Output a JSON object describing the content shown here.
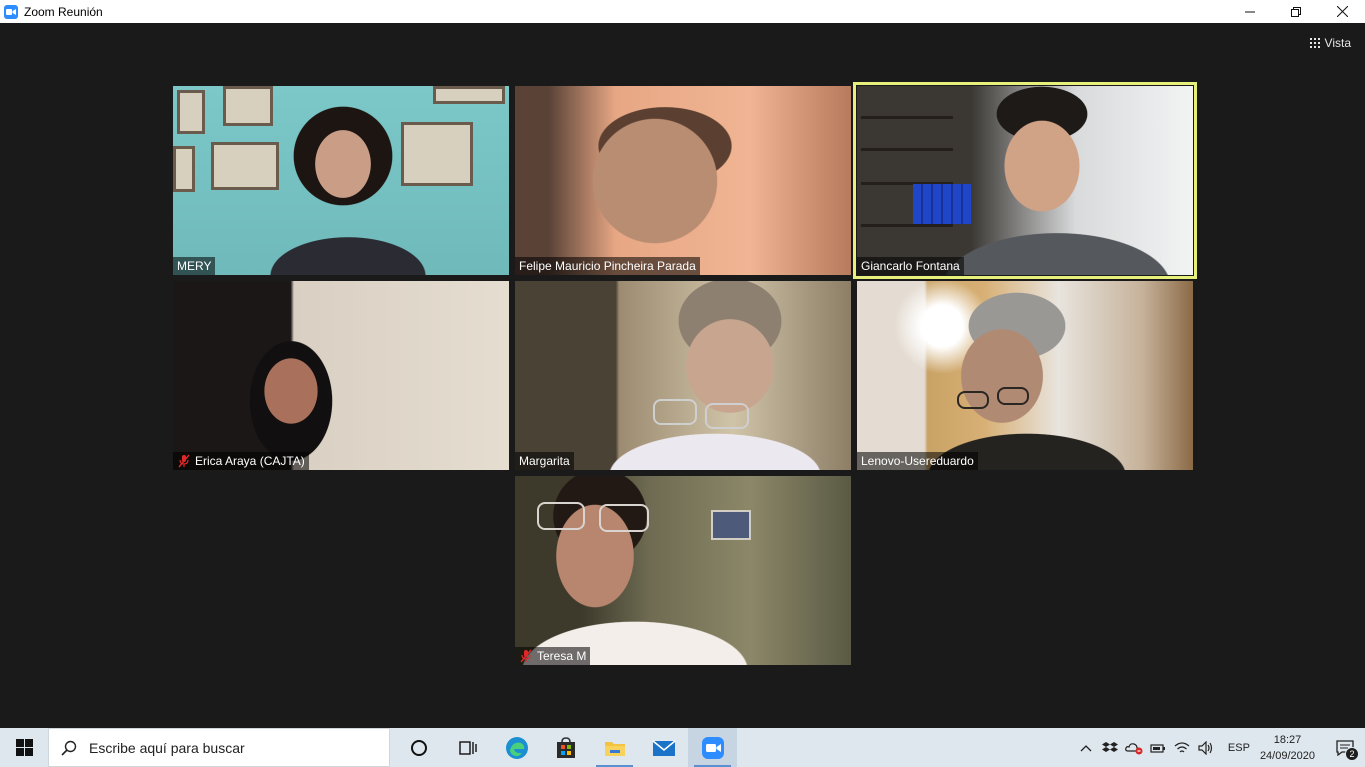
{
  "window": {
    "title": "Zoom Reunión",
    "app_icon": "zoom-icon",
    "controls": {
      "minimize": "—",
      "restore": "❐",
      "close": "✕"
    }
  },
  "meeting": {
    "view_label": "Vista",
    "active_speaker_color": "#e6f07a",
    "participants": [
      {
        "name": "MERY",
        "muted": false,
        "active": false
      },
      {
        "name": "Felipe Mauricio Pincheira Parada",
        "muted": false,
        "active": false
      },
      {
        "name": "Giancarlo Fontana",
        "muted": false,
        "active": true
      },
      {
        "name": "Erica Araya (CAJTA)",
        "muted": true,
        "active": false
      },
      {
        "name": "Margarita",
        "muted": false,
        "active": false
      },
      {
        "name": "Lenovo-Usereduardo",
        "muted": false,
        "active": false
      },
      {
        "name": "Teresa M",
        "muted": true,
        "active": false
      }
    ]
  },
  "taskbar": {
    "search_placeholder": "Escribe aquí para buscar",
    "pinned": [
      "cortana-icon",
      "task-view-icon",
      "edge-icon",
      "store-icon",
      "file-explorer-icon",
      "mail-icon",
      "zoom-icon"
    ],
    "language": "ESP",
    "time": "18:27",
    "date": "24/09/2020",
    "notification_count": "2"
  }
}
